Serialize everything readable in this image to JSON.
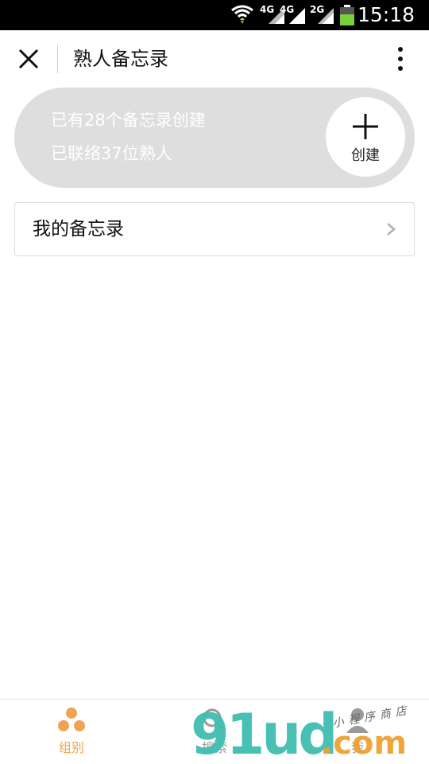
{
  "status_bar": {
    "network_1": "4G",
    "network_2": "4G",
    "network_3": "2G",
    "time": "15:18",
    "battery_color": "#7ad03a"
  },
  "header": {
    "title": "熟人备忘录",
    "close_icon": "close-icon",
    "more_icon": "more-vertical-icon"
  },
  "summary": {
    "memo_count_text": "已有28个备忘录创建",
    "contact_count_text": "已联络37位熟人",
    "create_label": "创建"
  },
  "list": {
    "items": [
      {
        "label": "我的备忘录",
        "icon": "chevron-right-icon"
      }
    ]
  },
  "tabbar": {
    "tabs": [
      {
        "label": "组别",
        "icon": "group-icon",
        "active": true
      },
      {
        "label": "搜索",
        "icon": "search-person-icon",
        "active": false
      },
      {
        "label": "我",
        "icon": "profile-icon",
        "active": false
      }
    ],
    "accent_color": "#f0a450"
  },
  "watermark": {
    "main": "91ud",
    "suffix": ".com",
    "small": "小程序商店"
  }
}
